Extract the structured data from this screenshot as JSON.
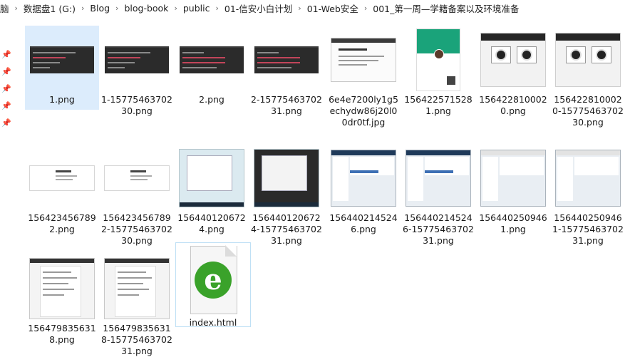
{
  "breadcrumb": [
    "脑",
    "数据盘1 (G:)",
    "Blog",
    "blog-book",
    "public",
    "01-信安小白计划",
    "01-Web安全",
    "001_第一周—学籍备案以及环境准备"
  ],
  "files": [
    {
      "name": "1.png"
    },
    {
      "name": "1-1577546370230.png"
    },
    {
      "name": "2.png"
    },
    {
      "name": "2-1577546370231.png"
    },
    {
      "name": "6e4e7200ly1g5echydw86j20l00dr0tf.jpg"
    },
    {
      "name": "1564225715281.png"
    },
    {
      "name": "1564228100020.png"
    },
    {
      "name": "1564228100020-1577546370230.png"
    },
    {
      "name": "1564234567892.png"
    },
    {
      "name": "1564234567892-1577546370230.png"
    },
    {
      "name": "1564401206724.png"
    },
    {
      "name": "1564401206724-1577546370231.png"
    },
    {
      "name": "1564402145246.png"
    },
    {
      "name": "1564402145246-1577546370231.png"
    },
    {
      "name": "1564402509461.png"
    },
    {
      "name": "1564402509461-1577546370231.png"
    },
    {
      "name": "1564798356318.png"
    },
    {
      "name": "1564798356318-1577546370231.png"
    },
    {
      "name": "index.html"
    }
  ],
  "selected_file": "1.png",
  "focused_file": "index.html",
  "pinned_count": 5
}
